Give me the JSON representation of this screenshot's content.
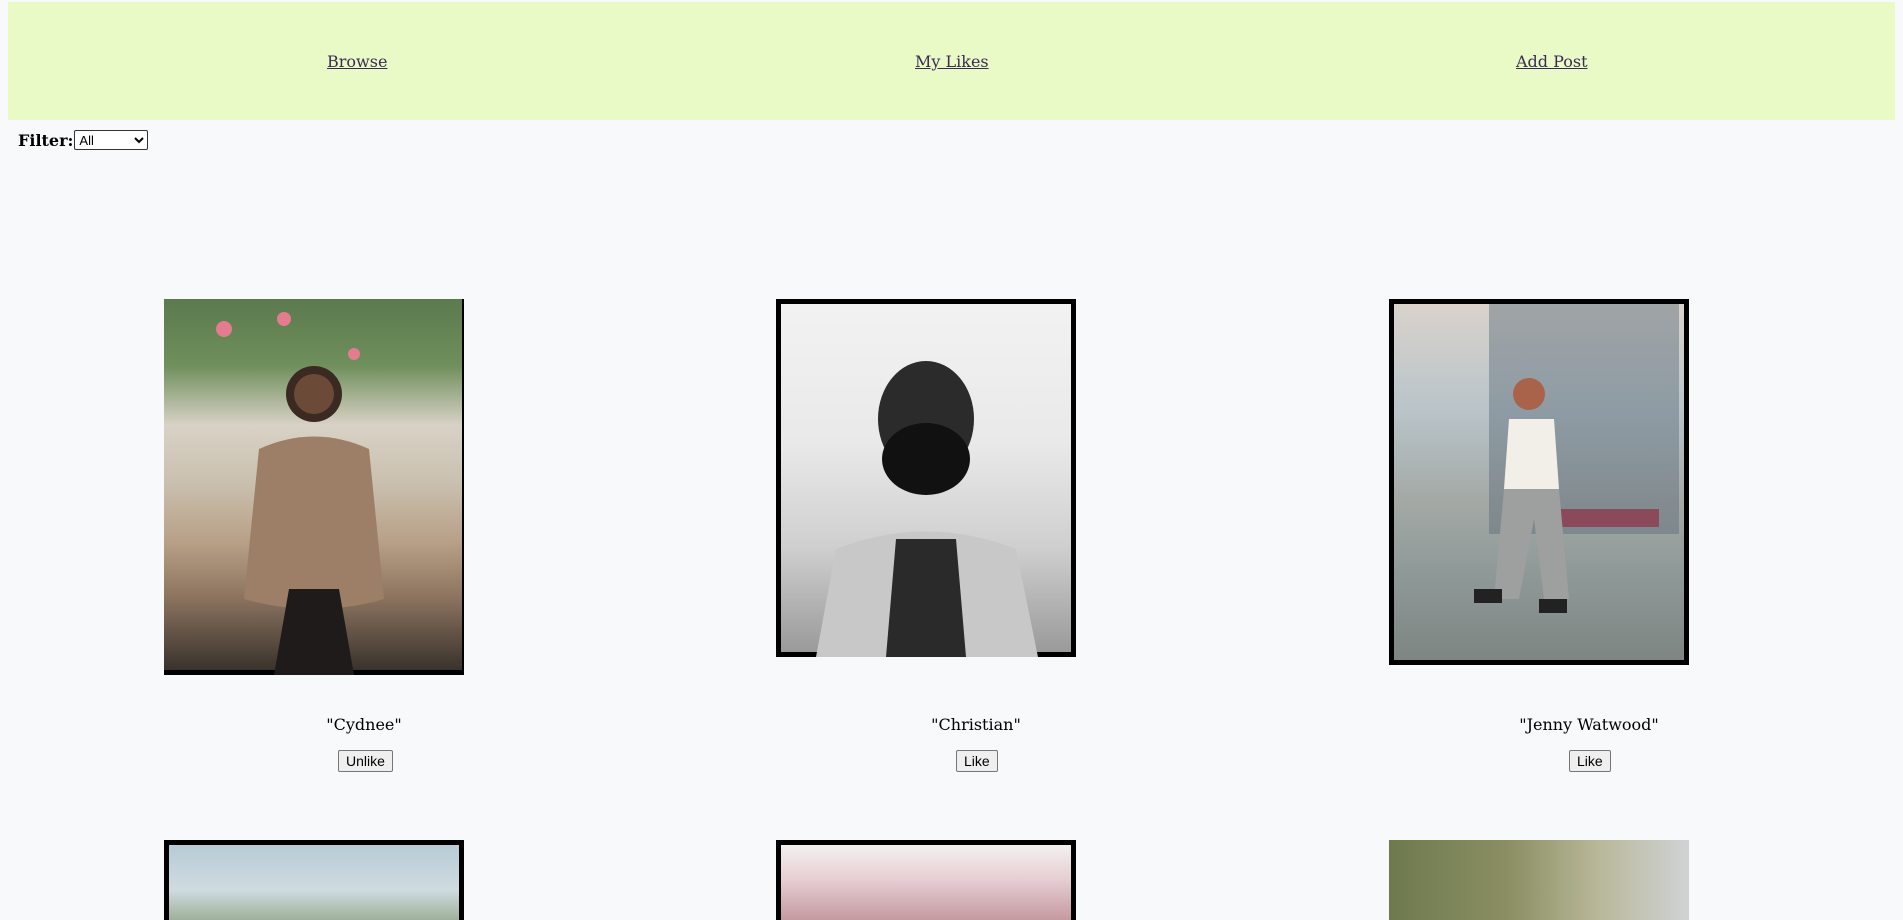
{
  "nav": {
    "browse": "Browse",
    "my_likes": "My Likes",
    "add_post": "Add Post"
  },
  "filter": {
    "label": "Filter:",
    "options": [
      "All"
    ],
    "selected": "All"
  },
  "posts": [
    {
      "name": "\"Cydnee\"",
      "button": "Unlike",
      "liked": true
    },
    {
      "name": "\"Christian\"",
      "button": "Like",
      "liked": false
    },
    {
      "name": "\"Jenny Watwood\"",
      "button": "Like",
      "liked": false
    }
  ],
  "colors": {
    "nav_bg": "#eafac7",
    "page_bg": "#f7f9fa",
    "link": "#3b2a55"
  }
}
